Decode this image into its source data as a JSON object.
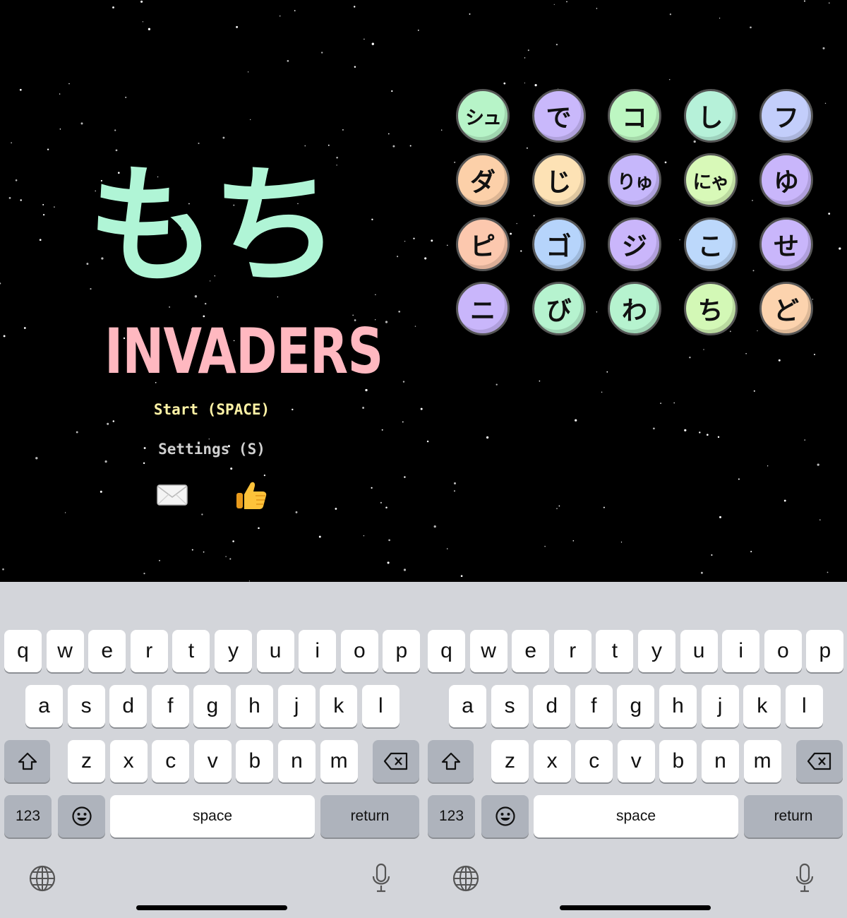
{
  "game": {
    "title_jp": "もち",
    "title_en": "INVADERS",
    "menu": {
      "start": "Start (SPACE)",
      "settings": "Settings (S)"
    },
    "icons": {
      "mail": "envelope-icon",
      "like": "thumbs-up-icon"
    },
    "title_jp_color": "#b0f5d6",
    "title_en_color": "#ffb8c0",
    "start_color": "#fff3a6",
    "settings_color": "#cfcfcf",
    "grid": [
      [
        {
          "label": "シュ",
          "color": "#b7f4c8"
        },
        {
          "label": "で",
          "color": "#c9b8fb"
        },
        {
          "label": "コ",
          "color": "#bdf7c2"
        },
        {
          "label": "し",
          "color": "#b6f1d9"
        },
        {
          "label": "フ",
          "color": "#c3cefb"
        }
      ],
      [
        {
          "label": "ダ",
          "color": "#fcd0a9"
        },
        {
          "label": "じ",
          "color": "#fde2b5"
        },
        {
          "label": "りゅ",
          "color": "#c6b7fb"
        },
        {
          "label": "にゃ",
          "color": "#d8f9b8"
        },
        {
          "label": "ゆ",
          "color": "#c9b6fb"
        }
      ],
      [
        {
          "label": "ピ",
          "color": "#fcc8ae"
        },
        {
          "label": "ゴ",
          "color": "#b6d4fb"
        },
        {
          "label": "ジ",
          "color": "#cab6fb"
        },
        {
          "label": "こ",
          "color": "#bcd8fb"
        },
        {
          "label": "せ",
          "color": "#c9b6fb"
        }
      ],
      [
        {
          "label": "ニ",
          "color": "#c9b6fb"
        },
        {
          "label": "び",
          "color": "#b6f3cf"
        },
        {
          "label": "わ",
          "color": "#b6f3cf"
        },
        {
          "label": "ち",
          "color": "#d3f8b6"
        },
        {
          "label": "ど",
          "color": "#fcd3ae"
        }
      ]
    ]
  },
  "keyboard": {
    "rows": [
      [
        "q",
        "w",
        "e",
        "r",
        "t",
        "y",
        "u",
        "i",
        "o",
        "p"
      ],
      [
        "a",
        "s",
        "d",
        "f",
        "g",
        "h",
        "j",
        "k",
        "l"
      ],
      [
        "z",
        "x",
        "c",
        "v",
        "b",
        "n",
        "m"
      ]
    ],
    "numbers_label": "123",
    "space_label": "space",
    "return_label": "return",
    "icons": {
      "shift": "shift-arrow-icon",
      "delete": "backspace-icon",
      "emoji": "emoji-smiley-icon",
      "globe": "globe-icon",
      "mic": "microphone-icon"
    },
    "background_color": "#d3d5da",
    "key_color": "#ffffff",
    "dark_key_color": "#aeb3bc"
  }
}
